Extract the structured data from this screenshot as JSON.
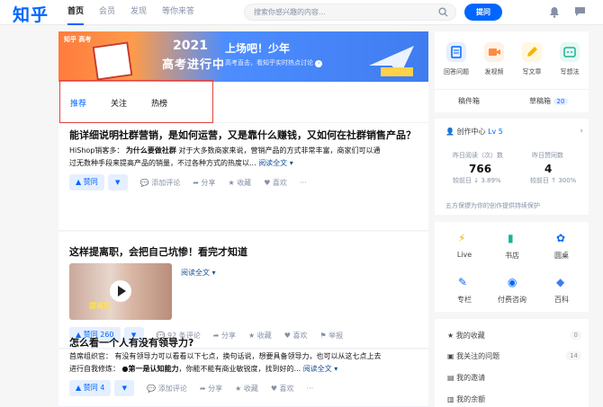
{
  "header": {
    "logo": "知乎",
    "nav": [
      "首页",
      "会员",
      "发现",
      "等你来答"
    ],
    "search_placeholder": "搜索你感兴趣的内容...",
    "ask_button": "提问"
  },
  "banner": {
    "school_tag": "知乎 高考",
    "year": "2021",
    "headline_art": "高考进行中",
    "headline": "上场吧！少年",
    "description": "高考直击，看知乎实时热点讨论"
  },
  "tabs": [
    "推荐",
    "关注",
    "热榜"
  ],
  "feed": [
    {
      "title": "能详细说明社群营销，是如何运营，又是靠什么赚钱，又如何在社群销售产品？",
      "author": "HiShop销客多：",
      "bold_lead": "为什么要做社群",
      "excerpt_line1": "对于大多数商家来说，营销产品的方式非常丰富，商家们可以通",
      "excerpt_line2": "过无数种手段来提高产品的销量，不过各种方式的热度以...",
      "read_all": "阅读全文",
      "vote": "赞同",
      "actions": [
        "添加评论",
        "分享",
        "收藏",
        "喜欢"
      ]
    },
    {
      "title": "这样提离职，会把自己坑惨！看完才知道",
      "read_all": "阅读全文",
      "thumb_caption": "提离职",
      "vote": "赞同 260",
      "actions": [
        "92 条评论",
        "分享",
        "收藏",
        "喜欢",
        "举报"
      ]
    },
    {
      "title": "怎么看一个人有没有领导力?",
      "author": "首席组织官：",
      "excerpt_line1": "有没有领导力可以看看以下七点，换句话说，想要具备领导力，也可以从这七点上去",
      "excerpt_pre": "进行自我修炼：",
      "bold_lead": "●第一是认知能力",
      "excerpt_line2": "，你能不能有商业敏锐度，找到好的...",
      "read_all": "阅读全文",
      "vote": "赞同 4",
      "actions": [
        "添加评论",
        "分享",
        "收藏",
        "喜欢"
      ]
    }
  ],
  "sidebar": {
    "creator_tools": [
      "回答问题",
      "发视频",
      "写文章",
      "写想法"
    ],
    "drafts": "稿件箱",
    "draft_box": "草稿箱",
    "draft_count": "20",
    "center_title": "创作中心",
    "level": "Lv 5",
    "yesterday_reads_label": "昨日阅读（次）数",
    "yesterday_reads": "766",
    "reads_change": "较前日 ↓ 3.89%",
    "yesterday_votes_label": "昨日赞同数",
    "yesterday_votes": "4",
    "votes_change": "较前日 ↑ 300%",
    "protection": "五方保镖为你的创作提供持续保护",
    "grid": [
      "Live",
      "书店",
      "圆桌",
      "专栏",
      "付费咨询",
      "百科"
    ],
    "links": [
      {
        "label": "我的收藏",
        "count": "0"
      },
      {
        "label": "我关注的问题",
        "count": "14"
      },
      {
        "label": "我的邀请",
        "count": ""
      },
      {
        "label": "我的余额",
        "count": ""
      }
    ]
  },
  "colors": {
    "brand": "#0066ff",
    "highlight_box": "#e0403c"
  }
}
